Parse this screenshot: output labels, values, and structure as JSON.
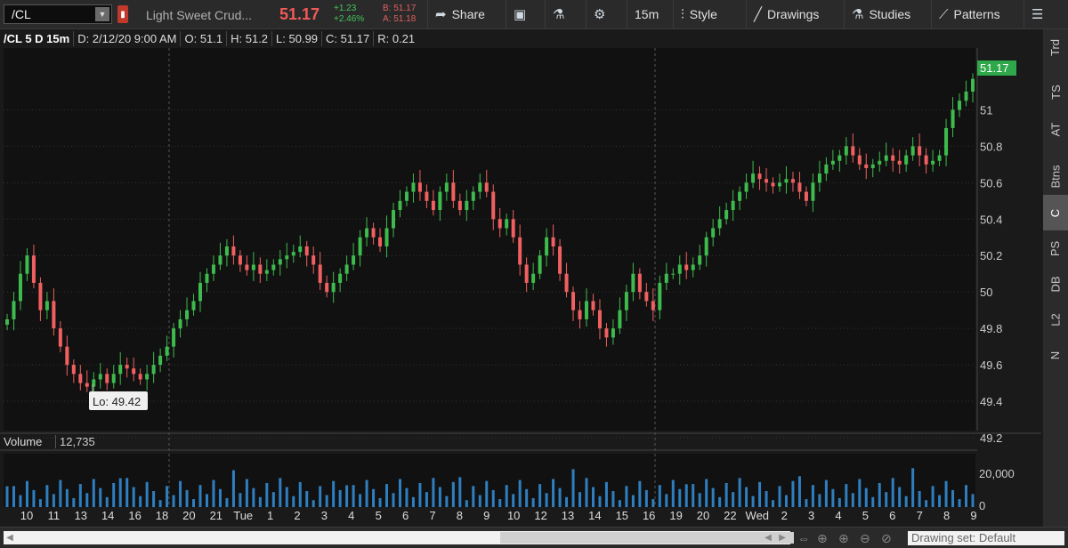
{
  "toolbar": {
    "symbol": "/CL",
    "description": "Light Sweet Crud...",
    "last_price": "51.17",
    "change_abs": "+1.23",
    "change_pct": "+2.46%",
    "bid": "B: 51.17",
    "ask": "A: 51.18",
    "share_label": "Share",
    "timeframe_label": "15m",
    "style_label": "Style",
    "drawings_label": "Drawings",
    "studies_label": "Studies",
    "patterns_label": "Patterns"
  },
  "infobar": {
    "symbol_period": "/CL 5 D 15m",
    "date": "D: 2/12/20 9:00 AM",
    "open": "O: 51.1",
    "high": "H: 51.2",
    "low": "L: 50.99",
    "close": "C: 51.17",
    "range": "R: 0.21"
  },
  "chart": {
    "last_price_tag": "51.17",
    "low_marker": "Lo: 49.42",
    "price_ticks": [
      "51",
      "50.8",
      "50.6",
      "50.4",
      "50.2",
      "50",
      "49.8",
      "49.6",
      "49.4",
      "49.2"
    ],
    "volume_label": "Volume",
    "volume_value": "12,735",
    "volume_tick": "20,000",
    "volume_zero": "0",
    "time_labels": [
      "10",
      "11",
      "13",
      "14",
      "16",
      "18",
      "20",
      "21",
      "Tue",
      "1",
      "2",
      "3",
      "4",
      "5",
      "6",
      "7",
      "8",
      "9",
      "10",
      "12",
      "13",
      "14",
      "15",
      "16",
      "19",
      "20",
      "22",
      "Wed",
      "2",
      "3",
      "4",
      "5",
      "6",
      "7",
      "8",
      "9"
    ]
  },
  "chart_data": {
    "type": "candlestick",
    "ylim": [
      49.2,
      51.3
    ],
    "close_series": [
      49.85,
      49.95,
      50.1,
      50.2,
      50.05,
      49.9,
      49.95,
      49.8,
      49.7,
      49.6,
      49.55,
      49.5,
      49.48,
      49.52,
      49.55,
      49.5,
      49.55,
      49.6,
      49.58,
      49.55,
      49.52,
      49.55,
      49.6,
      49.65,
      49.7,
      49.8,
      49.85,
      49.9,
      49.95,
      50.05,
      50.1,
      50.15,
      50.2,
      50.25,
      50.2,
      50.15,
      50.12,
      50.15,
      50.1,
      50.12,
      50.15,
      50.18,
      50.2,
      50.22,
      50.25,
      50.2,
      50.15,
      50.05,
      50.0,
      50.05,
      50.1,
      50.15,
      50.2,
      50.3,
      50.35,
      50.3,
      50.25,
      50.35,
      50.45,
      50.5,
      50.55,
      50.6,
      50.55,
      50.5,
      50.45,
      50.55,
      50.6,
      50.5,
      50.45,
      50.5,
      50.55,
      50.6,
      50.55,
      50.4,
      50.35,
      50.4,
      50.3,
      50.15,
      50.05,
      50.1,
      50.2,
      50.3,
      50.25,
      50.1,
      50.0,
      49.9,
      49.85,
      49.95,
      49.9,
      49.8,
      49.75,
      49.8,
      49.9,
      50.0,
      50.1,
      50.0,
      49.95,
      49.9,
      50.05,
      50.1,
      50.1,
      50.15,
      50.12,
      50.15,
      50.2,
      50.3,
      50.35,
      50.4,
      50.45,
      50.5,
      50.55,
      50.6,
      50.65,
      50.62,
      50.6,
      50.58,
      50.6,
      50.62,
      50.6,
      50.55,
      50.5,
      50.6,
      50.65,
      50.7,
      50.72,
      50.75,
      50.8,
      50.75,
      50.7,
      50.68,
      50.7,
      50.72,
      50.75,
      50.72,
      50.7,
      50.75,
      50.8,
      50.75,
      50.7,
      50.72,
      50.75,
      50.9,
      51.0,
      51.05,
      51.1,
      51.17
    ],
    "volume_max": 20000
  },
  "right_tabs": [
    "Trd",
    "TS",
    "AT",
    "Btns",
    "C",
    "PS",
    "DB",
    "L2",
    "N"
  ],
  "bottom": {
    "drawing_set": "Drawing set: Default"
  },
  "colors": {
    "up": "#3dbb4d",
    "down": "#f06060",
    "volume": "#2f7fc0",
    "price_tag": "#2ea84a"
  }
}
